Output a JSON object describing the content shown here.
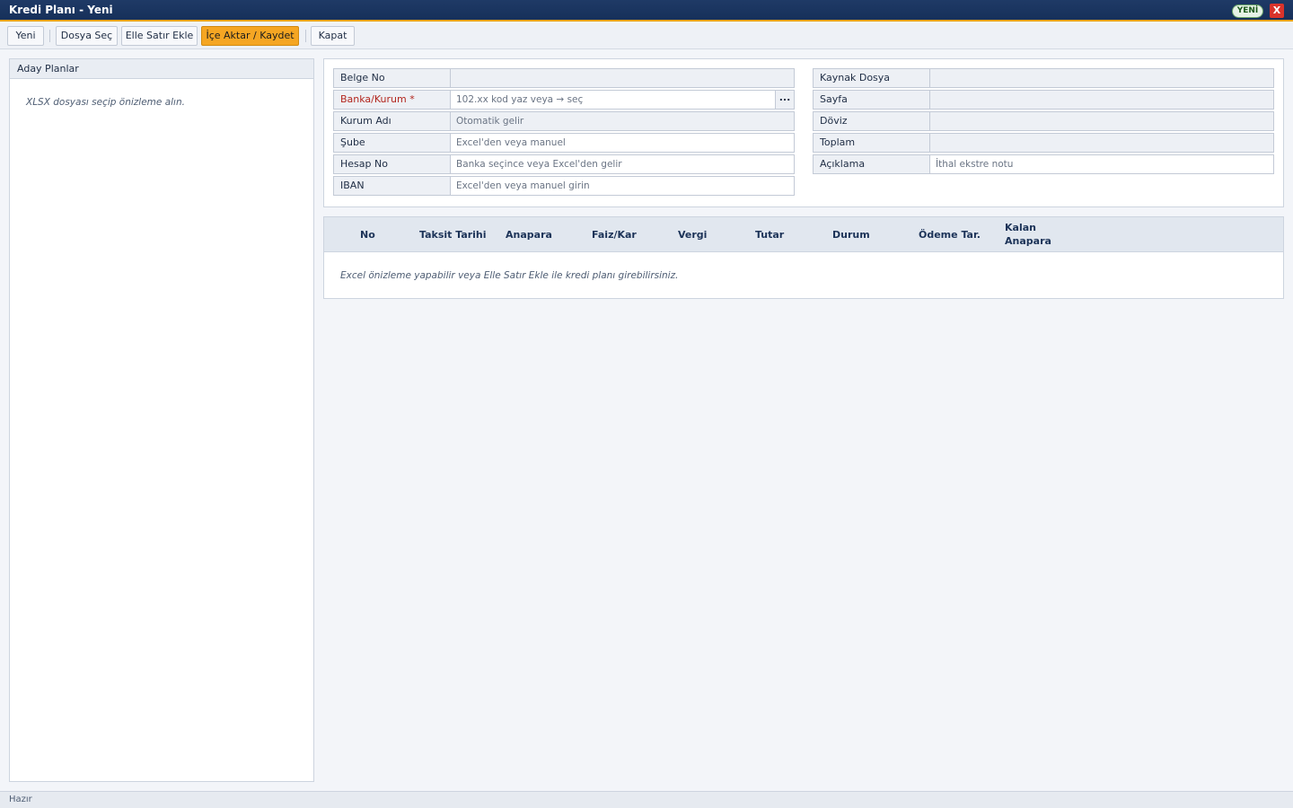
{
  "window": {
    "title": "Kredi Planı - Yeni",
    "badge": "YENİ",
    "close_label": "X"
  },
  "toolbar": {
    "new_label": "Yeni",
    "choose_file_label": "Dosya Seç",
    "add_row_label": "Elle Satır Ekle",
    "import_save_label": "İçe Aktar / Kaydet",
    "close_label": "Kapat"
  },
  "left_panel": {
    "title": "Aday Planlar",
    "empty_text": "XLSX dosyası seçip önizleme alın."
  },
  "form": {
    "left": [
      {
        "label": "Belge No",
        "value": "",
        "placeholder": ""
      },
      {
        "label": "Banka/Kurum *",
        "value": "",
        "placeholder": "102.xx kod yaz veya → seç",
        "required": true
      },
      {
        "label": "Kurum Adı",
        "value": "",
        "placeholder": "Otomatik gelir"
      },
      {
        "label": "Şube",
        "value": "",
        "placeholder": "Excel'den veya manuel"
      },
      {
        "label": "Hesap No",
        "value": "",
        "placeholder": "Banka seçince veya Excel'den gelir"
      },
      {
        "label": "IBAN",
        "value": "",
        "placeholder": "Excel'den veya manuel girin"
      }
    ],
    "right": [
      {
        "label": "Kaynak Dosya",
        "value": ""
      },
      {
        "label": "Sayfa",
        "value": ""
      },
      {
        "label": "Döviz",
        "value": ""
      },
      {
        "label": "Toplam",
        "value": ""
      },
      {
        "label": "Açıklama",
        "value": "",
        "placeholder": "İthal ekstre notu"
      }
    ],
    "lookup_button": "..."
  },
  "grid": {
    "columns": [
      "No",
      "Taksit Tarihi",
      "Anapara",
      "Faiz/Kar",
      "Vergi",
      "Tutar",
      "Durum",
      "Ödeme Tar.",
      "Kalan",
      "Anapara"
    ],
    "empty_text": "Excel önizleme yapabilir veya Elle Satır Ekle ile kredi planı girebilirsiniz."
  },
  "status": {
    "text": "Hazır"
  },
  "colors": {
    "titlebar": "#1f3a66",
    "accent": "#f5a623",
    "close": "#d9332b",
    "required": "#b3261e"
  }
}
